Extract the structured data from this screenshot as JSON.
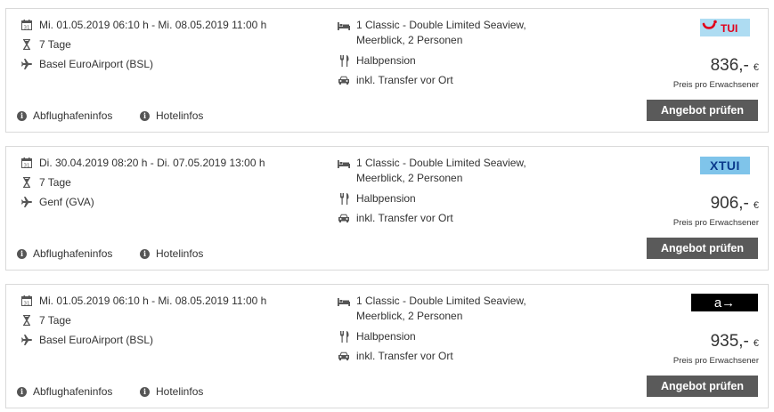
{
  "offers": [
    {
      "dates": "Mi. 01.05.2019 06:10 h - Mi. 08.05.2019 11:00 h",
      "duration": "7 Tage",
      "airport": "Basel EuroAirport (BSL)",
      "room_line1": "1 Classic - Double Limited Seaview,",
      "room_line2": "Meerblick, 2 Personen",
      "board": "Halbpension",
      "transfer": "inkl. Transfer vor Ort",
      "operator_logo": "TUI",
      "price": "836,-",
      "currency": "€",
      "price_note": "Preis pro Erwachsener",
      "button_label": "Angebot prüfen",
      "airport_info_label": "Abflughafeninfos",
      "hotel_info_label": "Hotelinfos"
    },
    {
      "dates": "Di. 30.04.2019 08:20 h - Di. 07.05.2019 13:00 h",
      "duration": "7 Tage",
      "airport": "Genf (GVA)",
      "room_line1": "1 Classic - Double Limited Seaview,",
      "room_line2": "Meerblick, 2 Personen",
      "board": "Halbpension",
      "transfer": "inkl. Transfer vor Ort",
      "operator_logo": "XTUI",
      "price": "906,-",
      "currency": "€",
      "price_note": "Preis pro Erwachsener",
      "button_label": "Angebot prüfen",
      "airport_info_label": "Abflughafeninfos",
      "hotel_info_label": "Hotelinfos"
    },
    {
      "dates": "Mi. 01.05.2019 06:10 h - Mi. 08.05.2019 11:00 h",
      "duration": "7 Tage",
      "airport": "Basel EuroAirport (BSL)",
      "room_line1": "1 Classic - Double Limited Seaview,",
      "room_line2": "Meerblick, 2 Personen",
      "board": "Halbpension",
      "transfer": "inkl. Transfer vor Ort",
      "operator_logo": "a→",
      "price": "935,-",
      "currency": "€",
      "price_note": "Preis pro Erwachsener",
      "button_label": "Angebot prüfen",
      "airport_info_label": "Abflughafeninfos",
      "hotel_info_label": "Hotelinfos"
    }
  ],
  "colors": {
    "button_bg": "#5a5a5a",
    "border": "#d9d9d9",
    "tui_red": "#e2001a",
    "tui_blue": "#0b3a8c",
    "tui_light_bg": "#aedcf2"
  }
}
